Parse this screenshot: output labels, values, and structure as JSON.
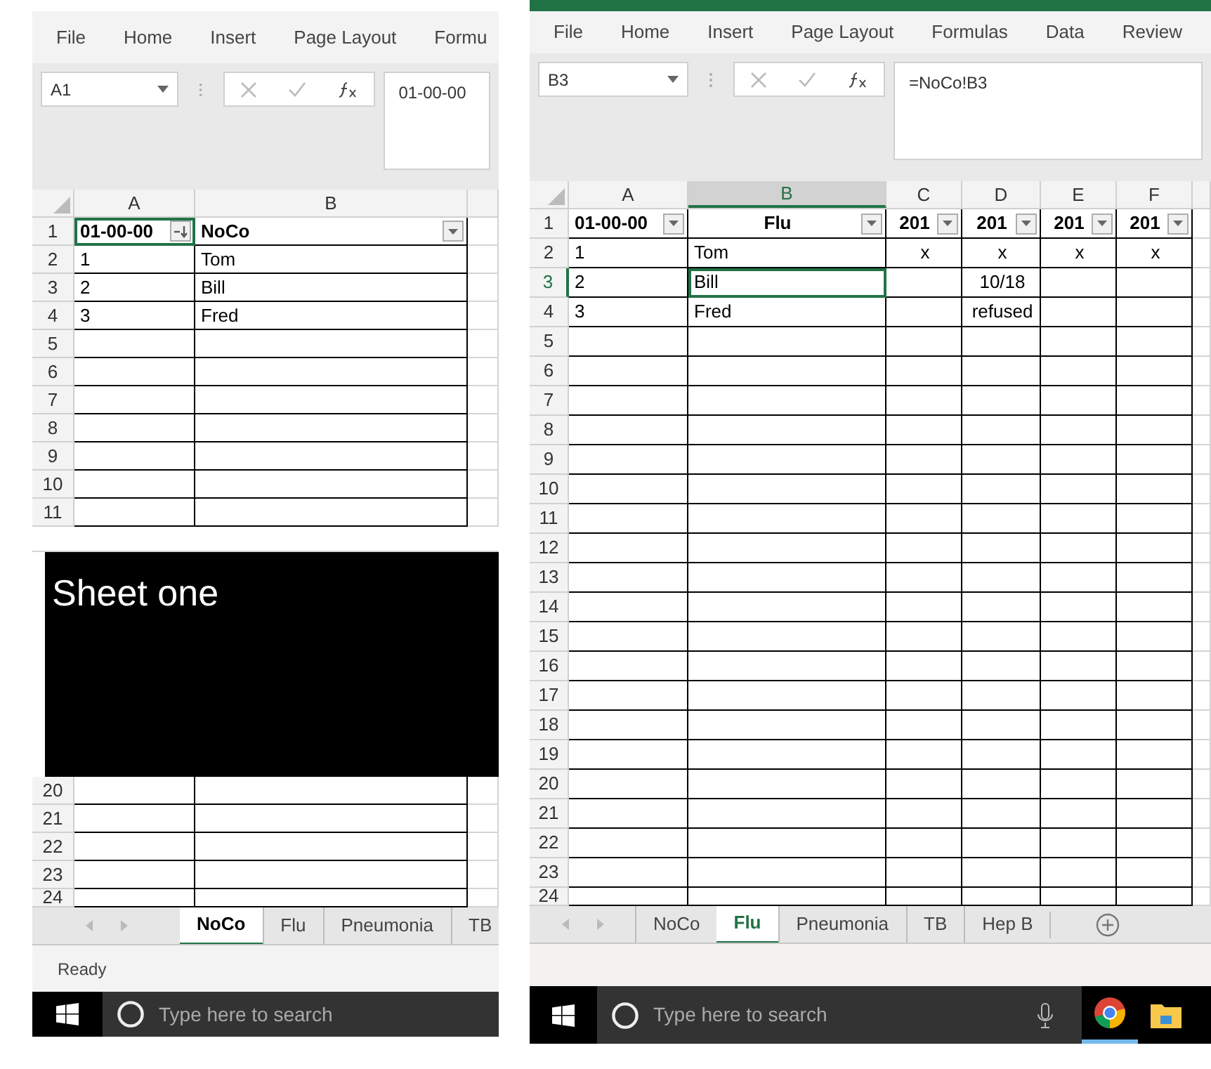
{
  "windows": [
    {
      "ribbon_tabs": [
        "File",
        "Home",
        "Insert",
        "Page Layout",
        "Formu"
      ],
      "name_box": "A1",
      "formula": "01-00-00",
      "columns": [
        {
          "label": "A",
          "selected": false
        },
        {
          "label": "B",
          "selected": false
        },
        {
          "selected": false
        }
      ],
      "rows": [
        {
          "number": "1",
          "selected": false,
          "kind": "header",
          "cells": [
            {
              "text": "01-00-00",
              "selected": true,
              "kind": "sort_filter"
            },
            {
              "text": "NoCo",
              "selected": false,
              "kind": "filter"
            },
            {
              "selected": false
            }
          ]
        },
        {
          "number": "2",
          "selected": false,
          "kind": "data",
          "cells": [
            {
              "text": "1",
              "selected": false
            },
            {
              "text": "Tom",
              "selected": false
            },
            {
              "selected": false
            }
          ]
        },
        {
          "number": "3",
          "selected": false,
          "kind": "data",
          "cells": [
            {
              "text": "2",
              "selected": false
            },
            {
              "text": "Bill",
              "selected": false
            },
            {
              "selected": false
            }
          ]
        },
        {
          "number": "4",
          "selected": false,
          "kind": "data",
          "cells": [
            {
              "text": "3",
              "selected": false
            },
            {
              "text": "Fred",
              "selected": false
            },
            {
              "selected": false
            }
          ]
        },
        {
          "number": "5",
          "selected": false,
          "kind": "data"
        },
        {
          "number": "6",
          "selected": false,
          "kind": "data"
        },
        {
          "number": "7",
          "selected": false,
          "kind": "data"
        },
        {
          "number": "8",
          "selected": false,
          "kind": "data"
        },
        {
          "number": "9",
          "selected": false,
          "kind": "data"
        },
        {
          "number": "10",
          "selected": false,
          "kind": "data"
        },
        {
          "number": "11",
          "selected": false,
          "kind": "data"
        },
        {
          "kind": "overlay",
          "label": "Sheet one"
        },
        {
          "number": "20",
          "selected": false,
          "kind": "data"
        },
        {
          "number": "21",
          "selected": false,
          "kind": "data"
        },
        {
          "number": "22",
          "selected": false,
          "kind": "data"
        },
        {
          "number": "23",
          "selected": false,
          "kind": "data"
        },
        {
          "number": "24",
          "selected": false,
          "kind": "partial"
        }
      ],
      "sheet_tabs": [
        {
          "label": "NoCo",
          "selected": true
        },
        {
          "label": "Flu",
          "selected": false
        },
        {
          "label": "Pneumonia",
          "selected": false
        },
        {
          "label": "TB",
          "selected": false
        }
      ],
      "status": "Ready",
      "taskbar": {
        "search_placeholder": "Type here to search"
      }
    },
    {
      "title_bar": true,
      "ribbon_tabs": [
        "File",
        "Home",
        "Insert",
        "Page Layout",
        "Formulas",
        "Data",
        "Review"
      ],
      "name_box": "B3",
      "formula": "=NoCo!B3",
      "columns": [
        {
          "label": "A",
          "selected": false
        },
        {
          "label": "B",
          "selected": true
        },
        {
          "label": "C",
          "selected": false
        },
        {
          "label": "D",
          "selected": false
        },
        {
          "label": "E",
          "selected": false
        },
        {
          "label": "F",
          "selected": false
        },
        {
          "selected": false
        }
      ],
      "rows": [
        {
          "number": "1",
          "selected": false,
          "kind": "header",
          "cells": [
            {
              "text": "01-00-00",
              "selected": false,
              "kind": "filter"
            },
            {
              "text": "Flu",
              "selected": false,
              "kind": "filter",
              "centered": true
            },
            {
              "text": "201",
              "selected": false,
              "kind": "filter",
              "centered": true
            },
            {
              "text": "201",
              "selected": false,
              "kind": "filter",
              "centered": true
            },
            {
              "text": "201",
              "selected": false,
              "kind": "filter",
              "centered": true
            },
            {
              "text": "201",
              "selected": false,
              "kind": "filter",
              "centered": true
            },
            {
              "selected": false
            }
          ]
        },
        {
          "number": "2",
          "selected": false,
          "kind": "data",
          "cells": [
            {
              "text": "1",
              "selected": false
            },
            {
              "text": "Tom",
              "selected": false
            },
            {
              "text": "x",
              "selected": false,
              "centered": true
            },
            {
              "text": "x",
              "selected": false,
              "centered": true
            },
            {
              "text": "x",
              "selected": false,
              "centered": true
            },
            {
              "text": "x",
              "selected": false,
              "centered": true
            },
            {
              "selected": false
            }
          ]
        },
        {
          "number": "3",
          "selected": true,
          "kind": "data",
          "cells": [
            {
              "text": "2",
              "selected": false
            },
            {
              "text": "Bill",
              "selected": true
            },
            {
              "selected": false
            },
            {
              "text": "10/18",
              "selected": false,
              "centered": true
            },
            {
              "selected": false
            },
            {
              "selected": false
            },
            {
              "selected": false
            }
          ]
        },
        {
          "number": "4",
          "selected": false,
          "kind": "data",
          "cells": [
            {
              "text": "3",
              "selected": false
            },
            {
              "text": "Fred",
              "selected": false
            },
            {
              "selected": false
            },
            {
              "text": "refused",
              "selected": false,
              "centered": true
            },
            {
              "selected": false
            },
            {
              "selected": false
            },
            {
              "selected": false
            }
          ]
        },
        {
          "number": "5",
          "selected": false,
          "kind": "data"
        },
        {
          "number": "6",
          "selected": false,
          "kind": "data"
        },
        {
          "number": "7",
          "selected": false,
          "kind": "data"
        },
        {
          "number": "8",
          "selected": false,
          "kind": "data"
        },
        {
          "number": "9",
          "selected": false,
          "kind": "data"
        },
        {
          "number": "10",
          "selected": false,
          "kind": "data"
        },
        {
          "number": "11",
          "selected": false,
          "kind": "data"
        },
        {
          "number": "12",
          "selected": false,
          "kind": "data"
        },
        {
          "number": "13",
          "selected": false,
          "kind": "data"
        },
        {
          "number": "14",
          "selected": false,
          "kind": "data"
        },
        {
          "number": "15",
          "selected": false,
          "kind": "data"
        },
        {
          "number": "16",
          "selected": false,
          "kind": "data"
        },
        {
          "number": "17",
          "selected": false,
          "kind": "data"
        },
        {
          "number": "18",
          "selected": false,
          "kind": "data"
        },
        {
          "number": "19",
          "selected": false,
          "kind": "data"
        },
        {
          "number": "20",
          "selected": false,
          "kind": "data"
        },
        {
          "number": "21",
          "selected": false,
          "kind": "data"
        },
        {
          "number": "22",
          "selected": false,
          "kind": "data"
        },
        {
          "number": "23",
          "selected": false,
          "kind": "data"
        },
        {
          "number": "24",
          "selected": false,
          "kind": "partial"
        }
      ],
      "sheet_tabs": [
        {
          "label": "NoCo",
          "selected": false
        },
        {
          "label": "Flu",
          "selected": true
        },
        {
          "label": "Pneumonia",
          "selected": false
        },
        {
          "label": "TB",
          "selected": false
        },
        {
          "label": "Hep B",
          "selected": false
        }
      ],
      "add_sheet": true,
      "taskbar": {
        "search_placeholder": "Type here to search",
        "mic": true,
        "apps": [
          {
            "kind": "browser",
            "selected": true
          },
          {
            "kind": "folder",
            "selected": false
          }
        ]
      }
    }
  ]
}
